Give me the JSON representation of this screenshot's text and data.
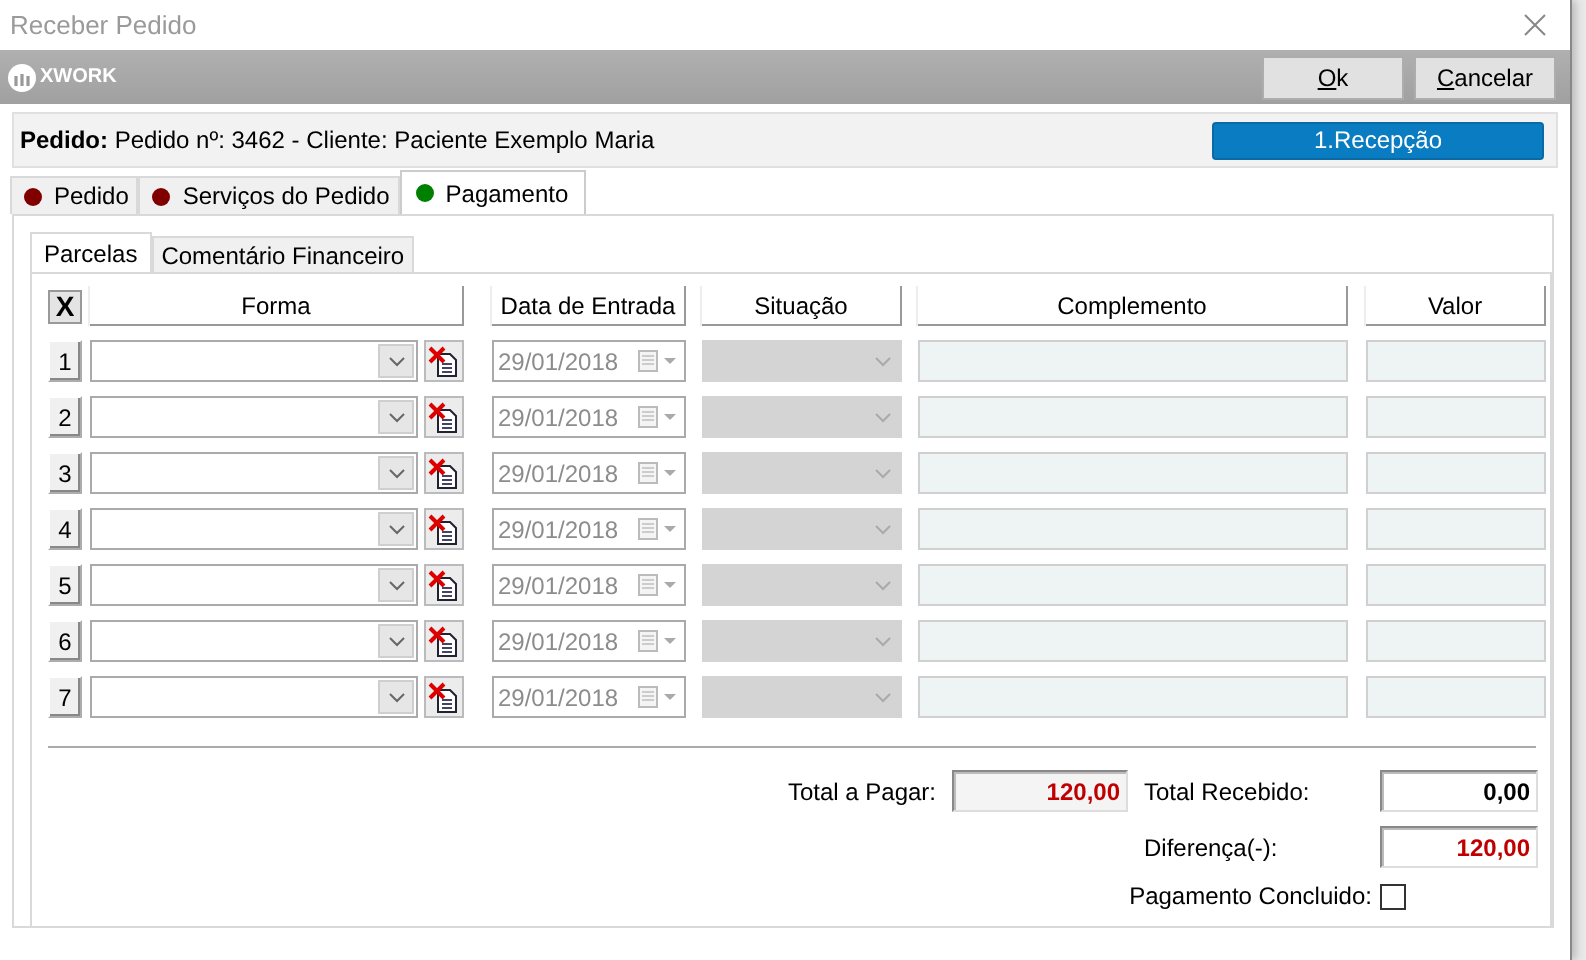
{
  "window": {
    "title": "Receber Pedido"
  },
  "header": {
    "logo": "XWORK",
    "buttons": [
      {
        "label": "Ok"
      },
      {
        "label": "Cancelar"
      }
    ]
  },
  "order": {
    "text": "**Pedido:** Pedido nº: 3462 - Cliente: Paciente Exemplo Maria",
    "stage": "1.Recepção"
  },
  "tabs": [
    {
      "label": "Pedido",
      "selected": false,
      "color": "#800000"
    },
    {
      "label": "Serviços do Pedido",
      "selected": false,
      "color": "#800000"
    },
    {
      "label": "Pagamento",
      "selected": true,
      "color": "#008000"
    }
  ],
  "subtabs": [
    {
      "label": "Parcelas",
      "selected": true
    },
    {
      "label": "Comentário Financeiro",
      "selected": false
    }
  ],
  "table": {
    "clear_button": "X",
    "columns": [
      "Forma",
      "Data de Entrada",
      "Situação",
      "Complemento",
      "Valor"
    ],
    "rows": [
      {
        "number": "1",
        "date": "29/01/2018"
      },
      {
        "number": "2",
        "date": "29/01/2018"
      },
      {
        "number": "3",
        "date": "29/01/2018"
      },
      {
        "number": "4",
        "date": "29/01/2018"
      },
      {
        "number": "5",
        "date": "29/01/2018"
      },
      {
        "number": "6",
        "date": "29/01/2018"
      },
      {
        "number": "7",
        "date": "29/01/2018"
      }
    ]
  },
  "totals": {
    "total_a_pagar": {
      "label": "Total a Pagar:",
      "value": "120,00",
      "color": "#c00000"
    },
    "total_recebido": {
      "label": "Total Recebido:",
      "value": "0,00",
      "color": "#000000"
    },
    "diferenca": {
      "label": "Diferença(-):",
      "value": "120,00",
      "color": "#c00000"
    },
    "pagamento_concluido": {
      "label": "Pagamento Concluido:",
      "checked": false
    }
  }
}
